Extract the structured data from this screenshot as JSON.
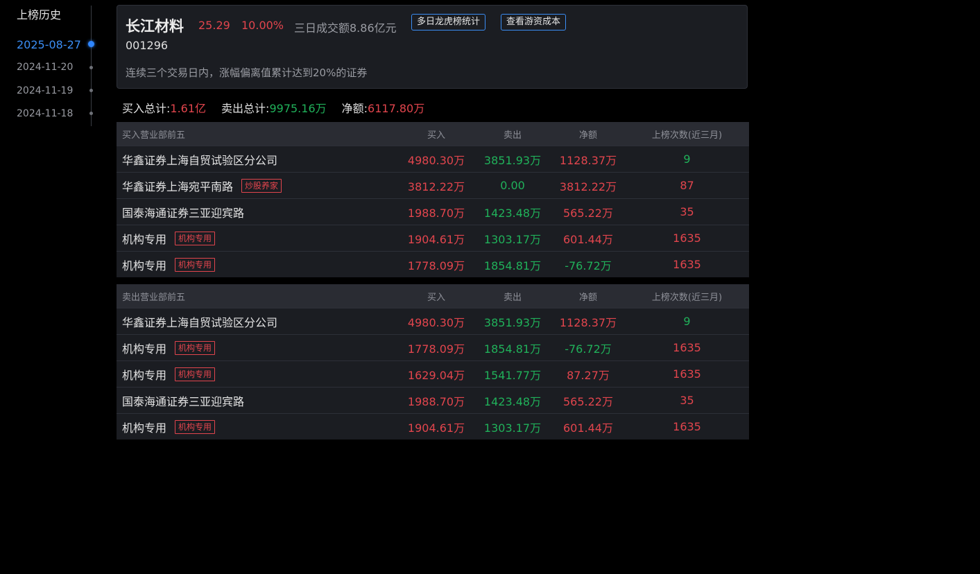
{
  "sidebar": {
    "title": "上榜历史",
    "dates": [
      {
        "label": "2025-08-27",
        "active": true
      },
      {
        "label": "2024-11-20",
        "active": false
      },
      {
        "label": "2024-11-19",
        "active": false
      },
      {
        "label": "2024-11-18",
        "active": false
      }
    ]
  },
  "stock": {
    "name": "长江材料",
    "price": "25.29",
    "change_pct": "10.00%",
    "turnover": "三日成交额8.86亿元",
    "code": "001296",
    "reason": "连续三个交易日内，涨幅偏离值累计达到20%的证券",
    "btn_multi": "多日龙虎榜统计",
    "btn_cost": "查看游资成本"
  },
  "totals": {
    "buy_label": "买入总计:",
    "buy_value": "1.61亿",
    "sell_label": "卖出总计:",
    "sell_value": "9975.16万",
    "net_label": "净额:",
    "net_value": "6117.80万"
  },
  "buy_table": {
    "headers": [
      "买入营业部前五",
      "买入",
      "卖出",
      "净额",
      "上榜次数(近三月)"
    ],
    "rows": [
      {
        "name": "华鑫证券上海自贸试验区分公司",
        "tag": "",
        "buy": "4980.30万",
        "sell": "3851.93万",
        "net": "1128.37万",
        "count": "9"
      },
      {
        "name": "华鑫证券上海宛平南路",
        "tag": "炒股养家",
        "buy": "3812.22万",
        "sell": "0.00",
        "net": "3812.22万",
        "count": "87"
      },
      {
        "name": "国泰海通证券三亚迎宾路",
        "tag": "",
        "buy": "1988.70万",
        "sell": "1423.48万",
        "net": "565.22万",
        "count": "35"
      },
      {
        "name": "机构专用",
        "tag": "机构专用",
        "buy": "1904.61万",
        "sell": "1303.17万",
        "net": "601.44万",
        "count": "1635"
      },
      {
        "name": "机构专用",
        "tag": "机构专用",
        "buy": "1778.09万",
        "sell": "1854.81万",
        "net": "-76.72万",
        "count": "1635"
      }
    ]
  },
  "sell_table": {
    "headers": [
      "卖出营业部前五",
      "买入",
      "卖出",
      "净额",
      "上榜次数(近三月)"
    ],
    "rows": [
      {
        "name": "华鑫证券上海自贸试验区分公司",
        "tag": "",
        "buy": "4980.30万",
        "sell": "3851.93万",
        "net": "1128.37万",
        "count": "9"
      },
      {
        "name": "机构专用",
        "tag": "机构专用",
        "buy": "1778.09万",
        "sell": "1854.81万",
        "net": "-76.72万",
        "count": "1635"
      },
      {
        "name": "机构专用",
        "tag": "机构专用",
        "buy": "1629.04万",
        "sell": "1541.77万",
        "net": "87.27万",
        "count": "1635"
      },
      {
        "name": "国泰海通证券三亚迎宾路",
        "tag": "",
        "buy": "1988.70万",
        "sell": "1423.48万",
        "net": "565.22万",
        "count": "35"
      },
      {
        "name": "机构专用",
        "tag": "机构专用",
        "buy": "1904.61万",
        "sell": "1303.17万",
        "net": "601.44万",
        "count": "1635"
      }
    ]
  },
  "colors": {
    "up": "#e2454d",
    "down": "#20b15a",
    "accent": "#3b8ef5"
  }
}
